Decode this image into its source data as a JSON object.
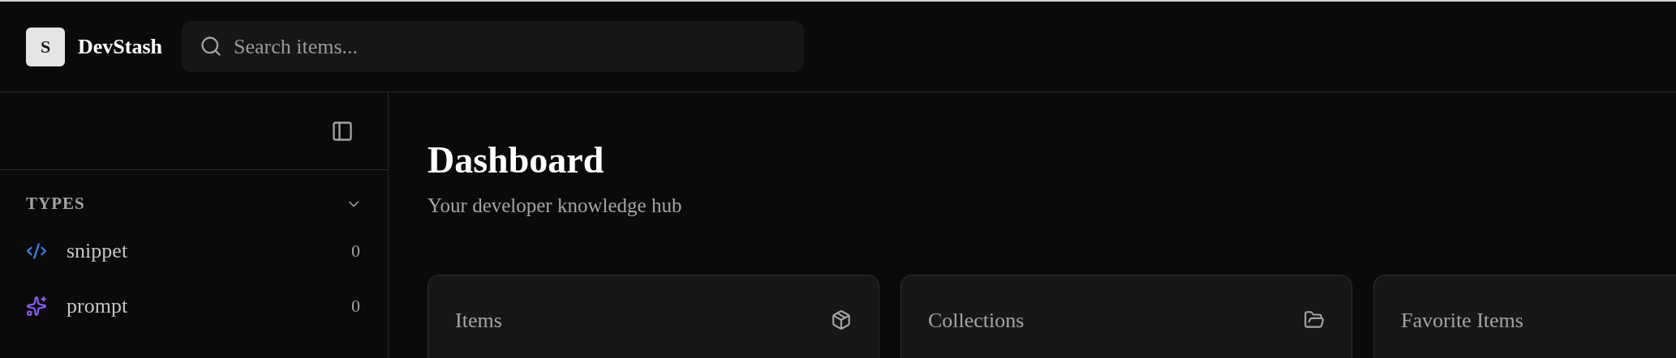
{
  "header": {
    "logo": "S",
    "brand": "DevStash",
    "search": {
      "placeholder": "Search items..."
    }
  },
  "sidebar": {
    "section": {
      "title": "TYPES",
      "expanded": true,
      "items": [
        {
          "kind": "snippet",
          "label": "snippet",
          "count": "0",
          "color": "#3b82f6"
        },
        {
          "kind": "prompt",
          "label": "prompt",
          "count": "0",
          "color": "#8b5cf6"
        }
      ]
    }
  },
  "main": {
    "title": "Dashboard",
    "subtitle": "Your developer knowledge hub",
    "cards": [
      {
        "title": "Items",
        "kind": "items"
      },
      {
        "title": "Collections",
        "kind": "collections"
      },
      {
        "title": "Favorite Items"
      }
    ]
  }
}
